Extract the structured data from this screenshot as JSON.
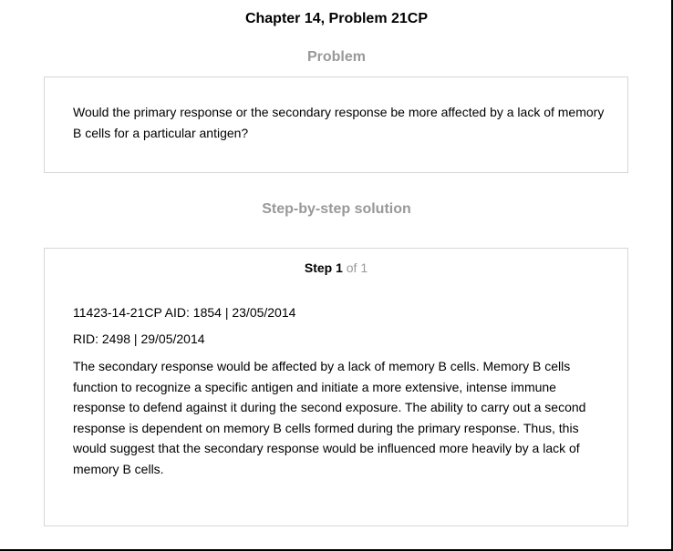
{
  "header": {
    "title": "Chapter 14, Problem 21CP"
  },
  "problem": {
    "heading": "Problem",
    "text": "Would the primary response or the secondary response be more affected by a lack of memory B cells for a particular antigen?"
  },
  "solution": {
    "heading": "Step-by-step solution",
    "step_label": "Step 1",
    "step_of": "of 1",
    "meta_line_1": "11423-14-21CP AID: 1854 | 23/05/2014",
    "meta_line_2": "RID: 2498 | 29/05/2014",
    "text": "The secondary response would be affected by a lack of memory B cells. Memory B cells function to recognize a specific antigen and initiate a more extensive, intense immune response to defend against it during the second exposure. The ability to carry out a second response is dependent on memory B cells formed during the primary response. Thus, this would suggest that the secondary response would be influenced more heavily by a lack of memory B cells."
  }
}
